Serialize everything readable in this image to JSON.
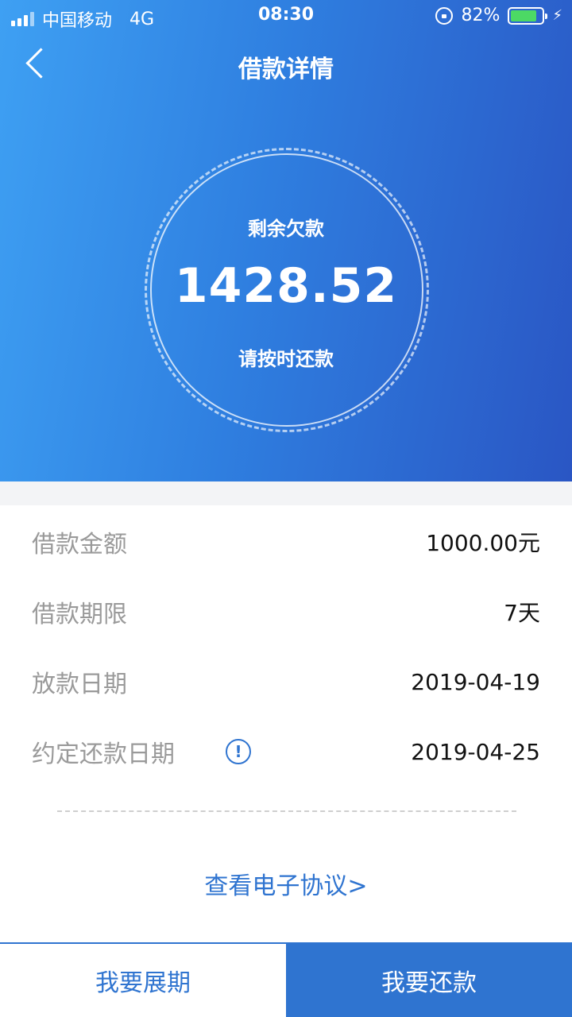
{
  "status_bar": {
    "carrier": "中国移动",
    "network": "4G",
    "time": "08:30",
    "battery": "82%"
  },
  "nav": {
    "title": "借款详情"
  },
  "summary": {
    "label": "剩余欠款",
    "amount": "1428.52",
    "tip": "请按时还款"
  },
  "details": [
    {
      "label": "借款金额",
      "value": "1000.00元"
    },
    {
      "label": "借款期限",
      "value": "7天"
    },
    {
      "label": "放款日期",
      "value": "2019-04-19"
    },
    {
      "label": "约定还款日期",
      "value": "2019-04-25"
    }
  ],
  "info_icon_glyph": "!",
  "agreement_link": "查看电子协议>",
  "actions": {
    "extend": "我要展期",
    "repay": "我要还款"
  },
  "colors": {
    "primary": "#2f74d0",
    "gradient_start": "#3ea0f3",
    "gradient_end": "#2a56c4",
    "battery": "#4cd964"
  }
}
